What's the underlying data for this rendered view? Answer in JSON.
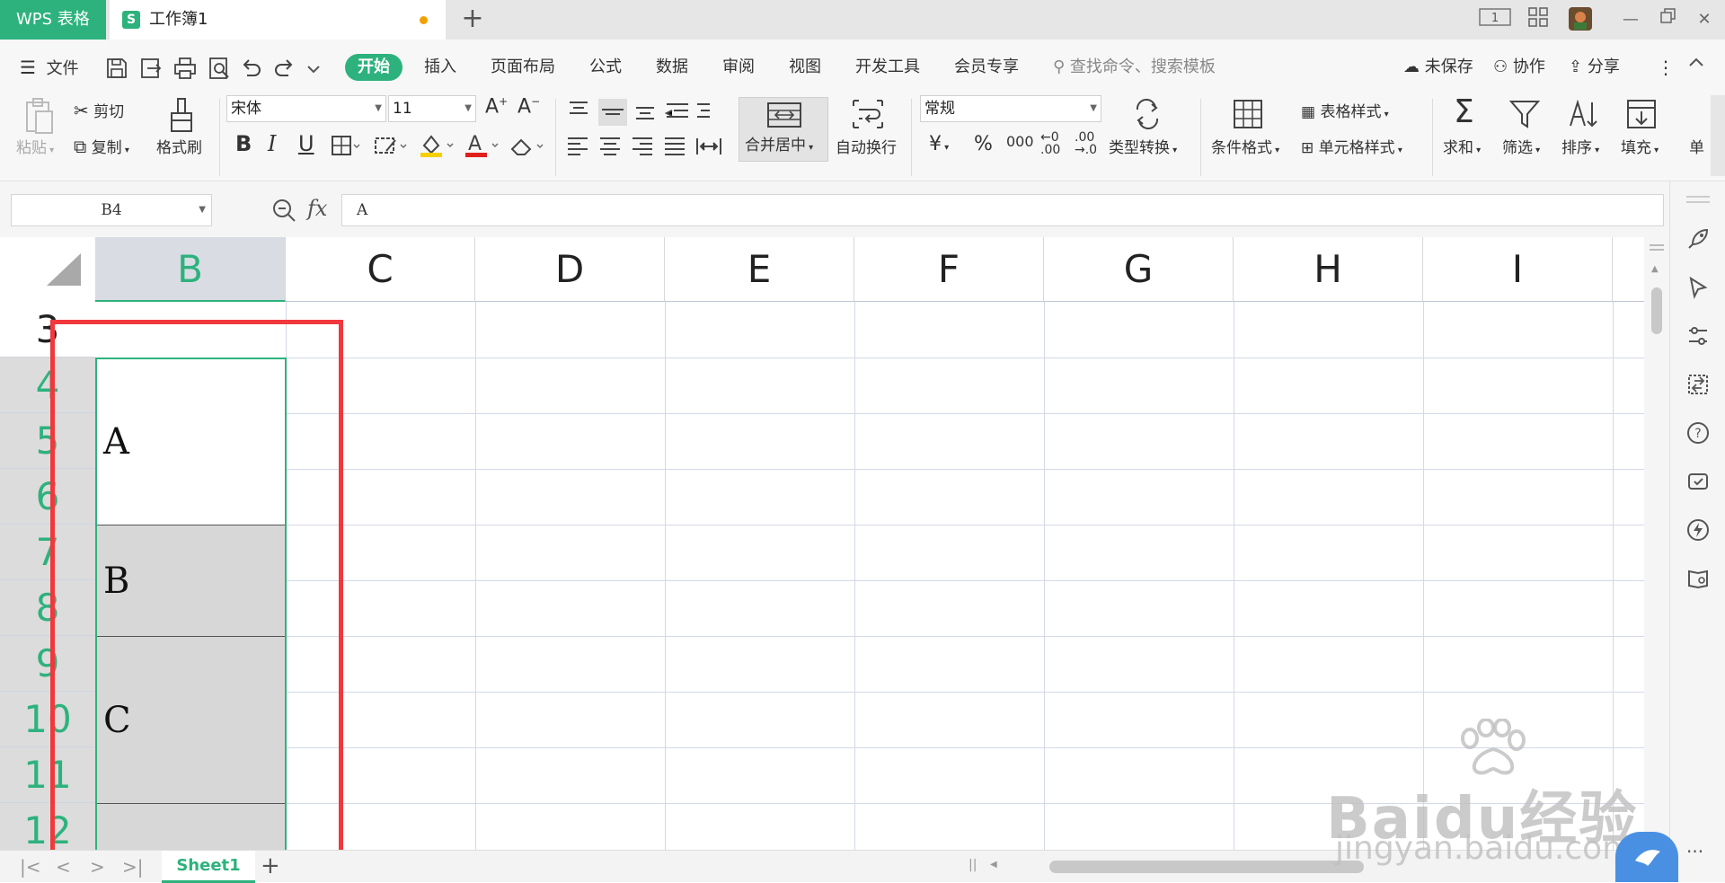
{
  "titlebar": {
    "app_tab": "WPS 表格",
    "doc_tab": "工作簿1",
    "doc_icon": "S",
    "page_badge": "1"
  },
  "menubar": {
    "file": "文件",
    "tabs": [
      "开始",
      "插入",
      "页面布局",
      "公式",
      "数据",
      "审阅",
      "视图",
      "开发工具",
      "会员专享"
    ],
    "search_placeholder": "查找命令、搜索模板",
    "unsaved": "未保存",
    "collab": "协作",
    "share": "分享"
  },
  "ribbon": {
    "paste": "粘贴",
    "cut": "剪切",
    "copy": "复制",
    "format_painter": "格式刷",
    "font_name": "宋体",
    "font_size": "11",
    "merge_center": "合并居中",
    "wrap_text": "自动换行",
    "number_format": "常规",
    "type_convert": "类型转换",
    "cond_format": "条件格式",
    "table_style": "表格样式",
    "cell_style": "单元格样式",
    "sum": "求和",
    "filter": "筛选",
    "sort": "排序",
    "fill": "填充",
    "single": "单"
  },
  "formula_bar": {
    "cell_ref": "B4",
    "fx": "fx",
    "content": "A"
  },
  "grid": {
    "columns": [
      "B",
      "C",
      "D",
      "E",
      "F",
      "G",
      "H",
      "I"
    ],
    "selected_column": "B",
    "rows": [
      "3",
      "4",
      "5",
      "6",
      "7",
      "8",
      "9",
      "10",
      "11",
      "12"
    ],
    "merged_cells": [
      "A",
      "B",
      "C"
    ]
  },
  "sheetbar": {
    "sheet_name": "Sheet1"
  },
  "watermark": {
    "brand": "Baidu经验",
    "url": "jingyan.baidu.com"
  },
  "colors": {
    "accent": "#2db27d",
    "highlight": "#f0383d"
  }
}
